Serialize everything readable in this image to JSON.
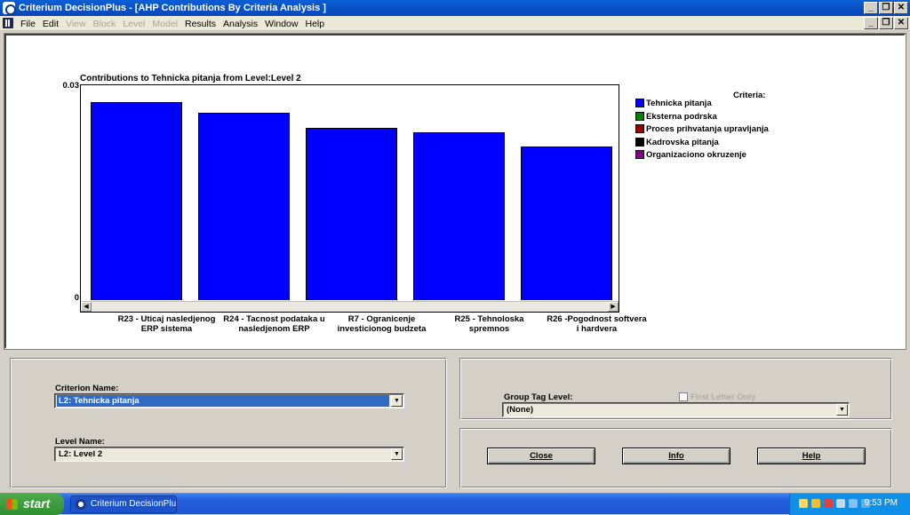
{
  "window": {
    "title": "Criterium DecisionPlus - [AHP Contributions By Criteria Analysis ]"
  },
  "caption_buttons": {
    "minimize": "_",
    "restore": "❐",
    "close": "✕"
  },
  "menu": [
    {
      "label": "File",
      "enabled": true
    },
    {
      "label": "Edit",
      "enabled": true
    },
    {
      "label": "View",
      "enabled": false
    },
    {
      "label": "Block",
      "enabled": false
    },
    {
      "label": "Level",
      "enabled": false
    },
    {
      "label": "Model",
      "enabled": false
    },
    {
      "label": "Results",
      "enabled": true
    },
    {
      "label": "Analysis",
      "enabled": true
    },
    {
      "label": "Window",
      "enabled": true
    },
    {
      "label": "Help",
      "enabled": true
    }
  ],
  "chart_data": {
    "type": "bar",
    "title": "Contributions to Tehnicka pitanja from Level:Level 2",
    "categories": [
      "R23 - Uticaj nasledjenog ERP sistema",
      "R24 - Tacnost podataka u nasledjenom ERP",
      "R7 - Ogranicenje investicionog budzeta",
      "R25 - Tehnoloska spremnos",
      "R26 -Pogodnost softvera i hardvera"
    ],
    "series": [
      {
        "name": "Tehnicka pitanja",
        "color": "#0000ff",
        "values": [
          0.0313,
          0.0296,
          0.0273,
          0.0266,
          0.0243
        ]
      }
    ],
    "ylim": [
      0,
      0.034
    ],
    "y_tick_labels": [
      "0.03",
      "0"
    ],
    "legend_title": "Criteria:",
    "legend": [
      {
        "name": "Tehnicka pitanja",
        "color": "#0000ff"
      },
      {
        "name": "Eksterna podrska",
        "color": "#008000"
      },
      {
        "name": "Proces prihvatanja upravljanja",
        "color": "#990000"
      },
      {
        "name": "Kadrovska pitanja",
        "color": "#000000"
      },
      {
        "name": "Organizaciono okruzenje",
        "color": "#800080"
      }
    ],
    "legend_position": "right"
  },
  "controls": {
    "criterion_label": "Criterion Name:",
    "criterion_value": "L2: Tehnicka pitanja",
    "level_label": "Level Name:",
    "level_value": "L2: Level 2",
    "group_tag_label": "Group Tag Level:",
    "group_tag_value": "(None)",
    "first_letter_label": "First Letter Only",
    "close_label": "Close",
    "info_label": "Info",
    "help_label": "Help"
  },
  "taskbar": {
    "start_label": "start",
    "task_label": "Criterium DecisionPlus....",
    "clock": "9:53 PM"
  }
}
